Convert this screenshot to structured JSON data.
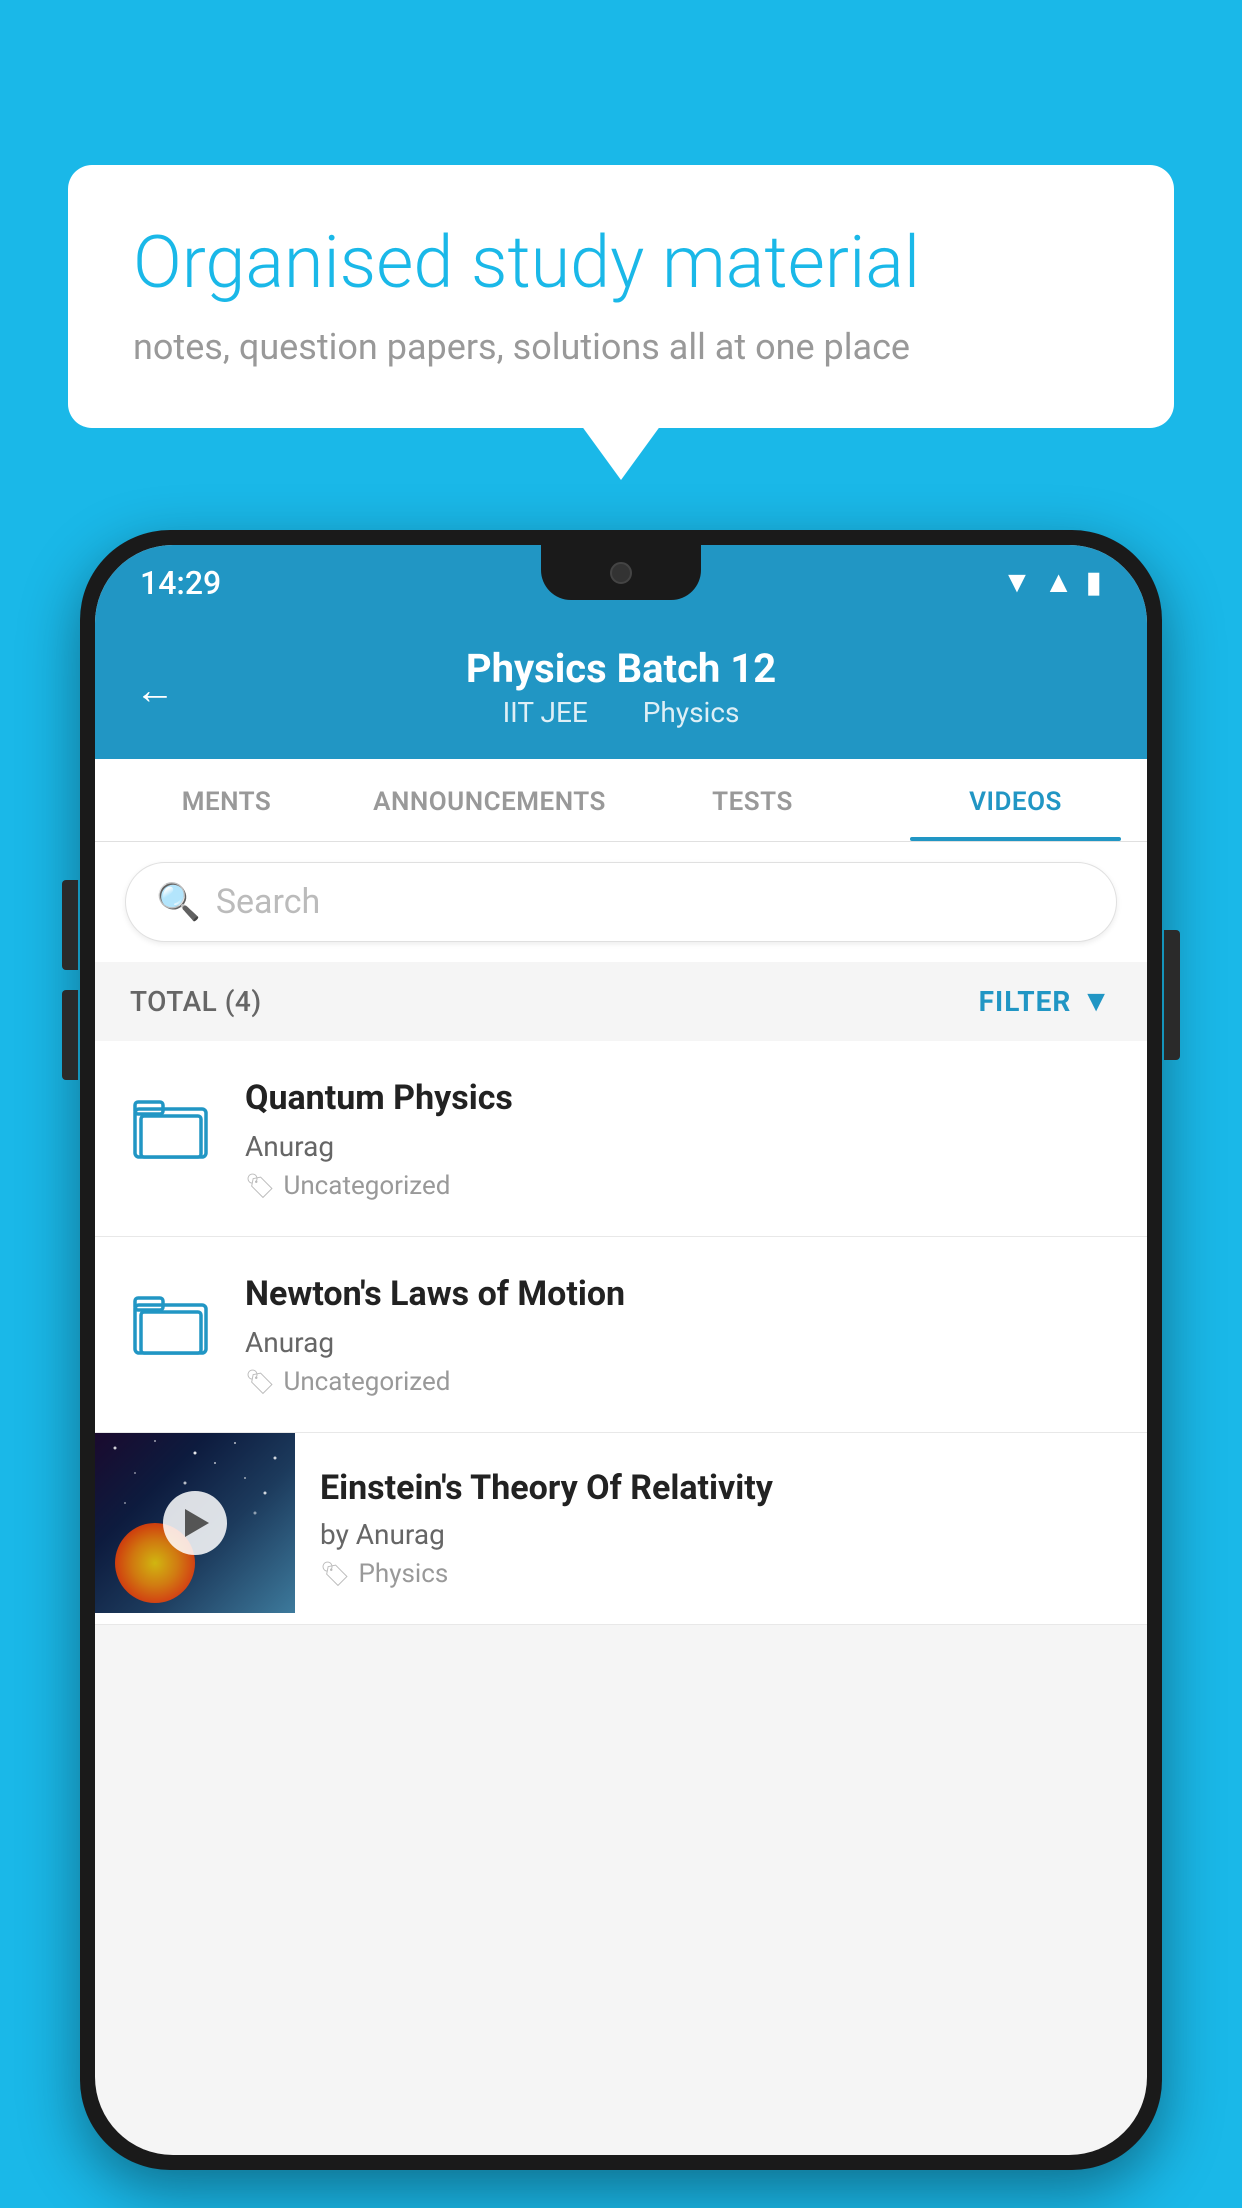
{
  "background": {
    "color": "#1ab8e8"
  },
  "speech_bubble": {
    "title": "Organised study material",
    "subtitle": "notes, question papers, solutions all at one place"
  },
  "phone": {
    "status_bar": {
      "time": "14:29",
      "icons": [
        "wifi",
        "signal",
        "battery"
      ]
    },
    "header": {
      "back_label": "←",
      "title": "Physics Batch 12",
      "subtitle_part1": "IIT JEE",
      "subtitle_part2": "Physics"
    },
    "tabs": [
      {
        "label": "MENTS",
        "active": false
      },
      {
        "label": "ANNOUNCEMENTS",
        "active": false
      },
      {
        "label": "TESTS",
        "active": false
      },
      {
        "label": "VIDEOS",
        "active": true
      }
    ],
    "search": {
      "placeholder": "Search"
    },
    "filter_bar": {
      "total_label": "TOTAL (4)",
      "filter_label": "FILTER"
    },
    "videos": [
      {
        "id": 1,
        "title": "Quantum Physics",
        "author": "Anurag",
        "tag": "Uncategorized",
        "type": "folder"
      },
      {
        "id": 2,
        "title": "Newton's Laws of Motion",
        "author": "Anurag",
        "tag": "Uncategorized",
        "type": "folder"
      },
      {
        "id": 3,
        "title": "Einstein's Theory Of Relativity",
        "author": "by Anurag",
        "tag": "Physics",
        "type": "video"
      }
    ]
  }
}
